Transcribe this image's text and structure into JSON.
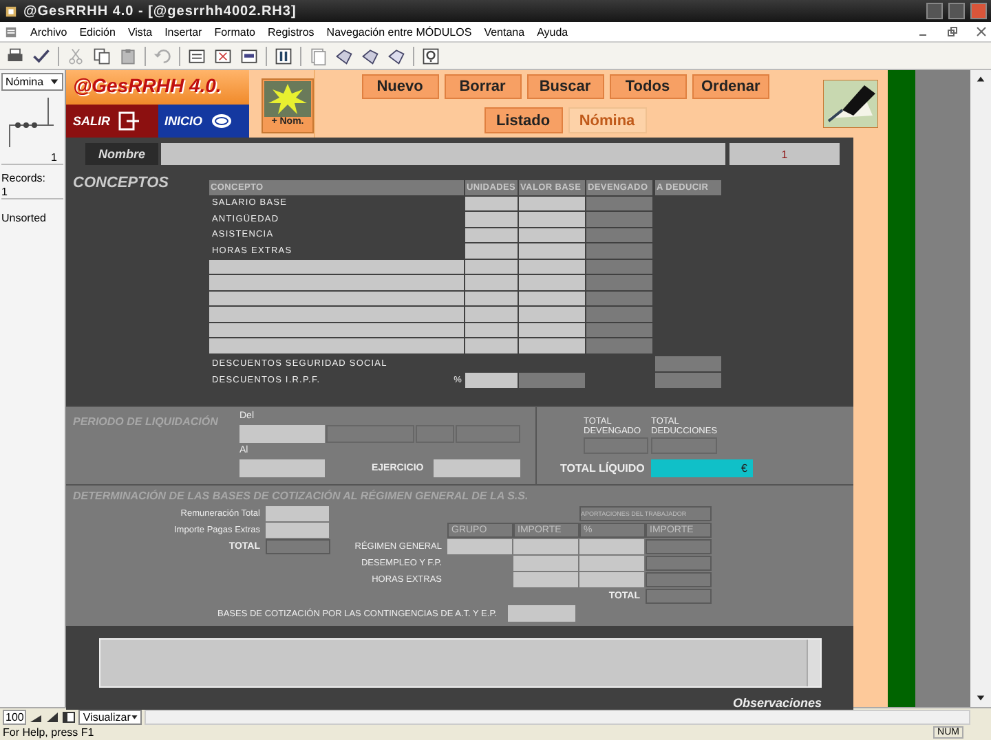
{
  "window": {
    "title": "@GesRRHH 4.0 - [@gesrrhh4002.RH3]"
  },
  "menu": [
    "Archivo",
    "Edición",
    "Vista",
    "Insertar",
    "Formato",
    "Registros",
    "Navegación entre MÓDULOS",
    "Ventana",
    "Ayuda"
  ],
  "status_panel": {
    "layout": "Nómina",
    "page": "1",
    "records_label": "Records:",
    "records": "1",
    "sort": "Unsorted"
  },
  "header": {
    "logo": "@GesRRHH 4.0.",
    "salir": "SALIR",
    "inicio": "INICIO",
    "new_payroll": "+ Nom.",
    "actions": [
      "Nuevo",
      "Borrar",
      "Buscar",
      "Todos",
      "Ordenar"
    ],
    "tabs": [
      {
        "label": "Listado",
        "selected": false
      },
      {
        "label": "Nómina",
        "selected": true
      }
    ]
  },
  "nombre": {
    "label": "Nombre",
    "number": "1"
  },
  "conceptos": {
    "title": "CONCEPTOS",
    "columns": [
      "CONCEPTO",
      "UNIDADES",
      "VALOR BASE",
      "DEVENGADO",
      "A DEDUCIR"
    ],
    "rows": [
      "SALARIO BASE",
      "ANTIGÜEDAD",
      "ASISTENCIA",
      "HORAS EXTRAS"
    ],
    "deductions": [
      {
        "label": "DESCUENTOS SEGURIDAD SOCIAL",
        "kind": "total"
      },
      {
        "label": "DESCUENTOS I.R.P.F.",
        "kind": "percent",
        "unit": "%"
      }
    ]
  },
  "periodo": {
    "title": "PERIODO DE LIQUIDACIÓN",
    "from_label": "Del",
    "to_label": "Al",
    "year_label": "EJERCICIO"
  },
  "totals": {
    "devengado": "TOTAL DEVENGADO",
    "deducciones": "TOTAL DEDUCCIONES",
    "liquido": "TOTAL LÍQUIDO",
    "currency": "€"
  },
  "bases": {
    "title": "DETERMINACIÓN DE LAS BASES DE COTIZACIÓN AL RÉGIMEN GENERAL DE LA S.S.",
    "inputs": [
      "Remuneración Total",
      "Importe Pagas Extras"
    ],
    "input_total": "TOTAL",
    "group_header": "APORTACIONES DEL TRABAJADOR",
    "columns": [
      "GRUPO",
      "IMPORTE",
      "%",
      "IMPORTE"
    ],
    "rows": [
      {
        "label": "RÉGIMEN GENERAL",
        "kind": "grouped"
      },
      {
        "label": "DESEMPLEO Y F.P.",
        "kind": "plain"
      },
      {
        "label": "HORAS EXTRAS",
        "kind": "plain"
      }
    ],
    "rows_total": "TOTAL",
    "contingencias": "BASES DE COTIZACIÓN POR LAS CONTINGENCIAS DE A.T. Y E.P."
  },
  "observaciones": {
    "label": "Observaciones"
  },
  "zoom": {
    "value": "100",
    "mode": "Visualizar"
  },
  "status_bar": {
    "help": "For Help, press F1",
    "num": "NUM"
  }
}
